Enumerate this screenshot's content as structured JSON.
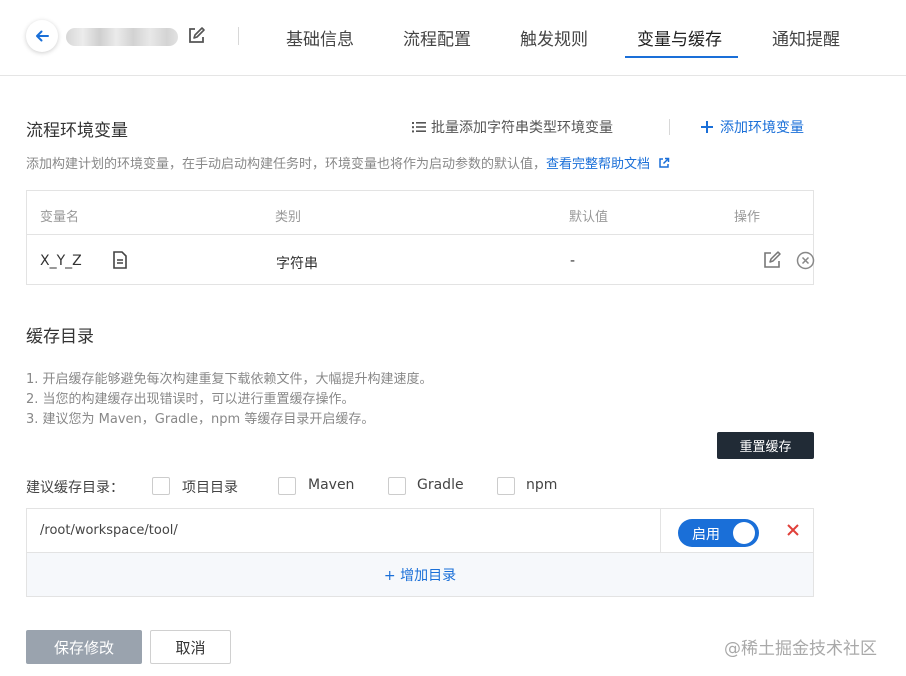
{
  "header": {
    "tabs": [
      {
        "label": "基础信息",
        "active": false
      },
      {
        "label": "流程配置",
        "active": false
      },
      {
        "label": "触发规则",
        "active": false
      },
      {
        "label": "变量与缓存",
        "active": true
      },
      {
        "label": "通知提醒",
        "active": false
      }
    ]
  },
  "env": {
    "title": "流程环境变量",
    "bulk_add": "批量添加字符串类型环境变量",
    "add": "添加环境变量",
    "desc": "添加构建计划的环境变量，在手动启动构建任务时，环境变量也将作为启动参数的默认值，",
    "help_link": "查看完整帮助文档",
    "columns": [
      "变量名",
      "类别",
      "默认值",
      "操作"
    ],
    "rows": [
      {
        "name": "X_Y_Z",
        "type": "字符串",
        "default": "-"
      }
    ]
  },
  "cache": {
    "title": "缓存目录",
    "tips": [
      "1. 开启缓存能够避免每次构建重复下载依赖文件，大幅提升构建速度。",
      "2. 当您的构建缓存出现错误时，可以进行重置缓存操作。",
      "3. 建议您为 Maven，Gradle，npm 等缓存目录开启缓存。"
    ],
    "reset": "重置缓存",
    "suggest_label": "建议缓存目录：",
    "options": [
      {
        "label": "项目目录",
        "checked": false
      },
      {
        "label": "Maven",
        "checked": false
      },
      {
        "label": "Gradle",
        "checked": false
      },
      {
        "label": "npm",
        "checked": false
      }
    ],
    "dirs": [
      {
        "path": "/root/workspace/tool/",
        "toggle": "启用",
        "enabled": true
      }
    ],
    "add_dir": "+ 增加目录"
  },
  "footer": {
    "save": "保存修改",
    "cancel": "取消"
  },
  "watermark": "@稀土掘金技术社区",
  "colors": {
    "accent": "#1a6fd8",
    "dark_button": "#212b36",
    "danger": "#e0403a",
    "disabled_button": "#9aa3ae"
  }
}
